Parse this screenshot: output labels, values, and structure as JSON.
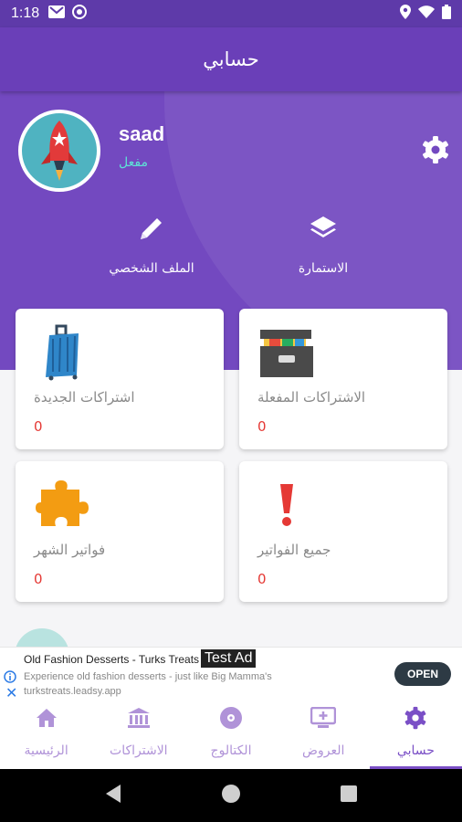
{
  "status_bar": {
    "time": "1:18"
  },
  "app_bar": {
    "title": "حسابي"
  },
  "profile": {
    "username": "saad",
    "status": "مفعل"
  },
  "actions": [
    {
      "label": "الملف الشخصي",
      "icon": "pencil-icon"
    },
    {
      "label": "الاستمارة",
      "icon": "layers-icon"
    }
  ],
  "cards": [
    {
      "title": "الاشتراكات المفعلة",
      "count": "0",
      "icon": "file-box-icon"
    },
    {
      "title": "اشتراكات الجديدة",
      "count": "0",
      "icon": "suitcase-icon"
    },
    {
      "title": "جميع الفواتير",
      "count": "0",
      "icon": "exclamation-icon"
    },
    {
      "title": "فواتير الشهر",
      "count": "0",
      "icon": "puzzle-icon"
    }
  ],
  "ad": {
    "title": "Old Fashion Desserts - Turks Treats",
    "label": "Test Ad",
    "description": "Experience old fashion desserts - just like Big Mamma's turkstreats.leadsy.app",
    "cta": "OPEN",
    "close": "✕"
  },
  "bottom_nav": [
    {
      "label": "الرئيسية",
      "icon": "home-icon"
    },
    {
      "label": "الاشتراكات",
      "icon": "bank-icon"
    },
    {
      "label": "الكتالوج",
      "icon": "disc-icon"
    },
    {
      "label": "العروض",
      "icon": "tv-plus-icon"
    },
    {
      "label": "حسابي",
      "icon": "settings-icon",
      "active": true
    }
  ],
  "colors": {
    "primary": "#6a3fb8",
    "accent_status": "#5ee3d6",
    "count_red": "#e53935"
  }
}
